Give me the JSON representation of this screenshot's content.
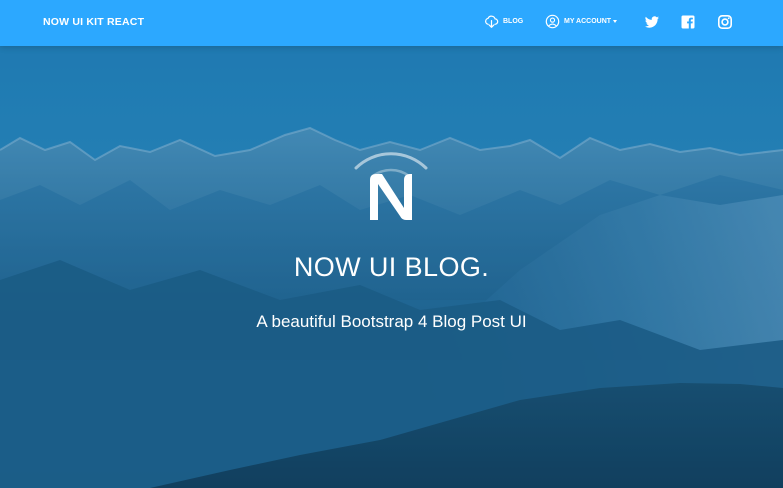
{
  "navbar": {
    "brand": "NOW UI KIT REACT",
    "items": [
      {
        "label": "BLOG",
        "icon": "cloud-download-icon"
      },
      {
        "label": "MY ACCOUNT",
        "icon": "user-circle-icon"
      }
    ],
    "social": [
      {
        "icon": "twitter-icon"
      },
      {
        "icon": "facebook-icon"
      },
      {
        "icon": "instagram-icon"
      }
    ],
    "background_color": "#2CA8FF"
  },
  "hero": {
    "logo_icon": "now-ui-logo-icon",
    "title": "NOW UI BLOG.",
    "subtitle": "A beautiful Bootstrap 4 Blog Post UI",
    "overlay_color": "#1A6FA0"
  }
}
